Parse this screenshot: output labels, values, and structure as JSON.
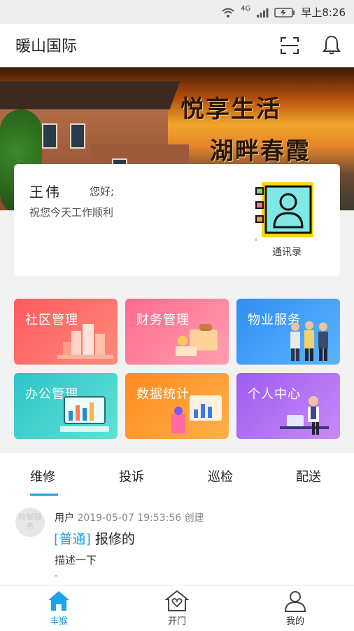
{
  "status_bar": {
    "time": "早上8:26",
    "network": "4G"
  },
  "header": {
    "title": "暖山国际"
  },
  "banner": {
    "slogan_line1": "悦享生活",
    "slogan_line2": "湖畔春霞"
  },
  "user_card": {
    "name": "王伟",
    "greeting": "您好;",
    "wish": "祝您今天工作顺利",
    "contacts_label": "通讯录"
  },
  "tiles": [
    {
      "label": "社区管理",
      "color_from": "#ff5a5f",
      "color_to": "#ff8a7a"
    },
    {
      "label": "财务管理",
      "color_from": "#ff6a8f",
      "color_to": "#ff9fb0"
    },
    {
      "label": "物业服务",
      "color_from": "#2f8ef2",
      "color_to": "#5bb4ff"
    },
    {
      "label": "办公管理",
      "color_from": "#2ec4c8",
      "color_to": "#5ee2d4"
    },
    {
      "label": "数据统计",
      "color_from": "#ff8a1e",
      "color_to": "#ffb04a"
    },
    {
      "label": "个人中心",
      "color_from": "#9d5cf0",
      "color_to": "#c88af8"
    }
  ],
  "tabs": [
    {
      "label": "维修",
      "active": true
    },
    {
      "label": "投诉",
      "active": false
    },
    {
      "label": "巡检",
      "active": false
    },
    {
      "label": "配送",
      "active": false
    }
  ],
  "record": {
    "avatar_text": "校智服务",
    "user": "用户",
    "timestamp": "2019-05-07 19:53:56",
    "action": "创建",
    "priority": "普通",
    "title": "报修的",
    "description": "描述一下",
    "tail": "-"
  },
  "bottom_nav": [
    {
      "label": "丰猴",
      "icon": "home-icon",
      "active": true
    },
    {
      "label": "开门",
      "icon": "door-heart-icon",
      "active": false
    },
    {
      "label": "我的",
      "icon": "user-icon",
      "active": false
    }
  ],
  "colors": {
    "accent": "#1aa3e8"
  }
}
